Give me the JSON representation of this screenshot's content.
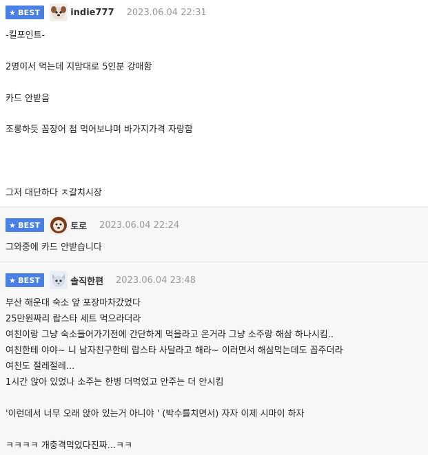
{
  "badge_label": "BEST",
  "colors": {
    "badge": "#4a80e6",
    "date": "#9a9a9a",
    "divider": "#e4e4e4"
  },
  "comments": [
    {
      "nickname": "indie777",
      "avatar": "dog-avatar",
      "datetime": "2023.06.04 22:31",
      "lines": [
        "-킬포인트-",
        "2명이서 먹는데 지맘대로 5인분 강매함",
        "카드 안받음",
        "조롱하듯 꼼장어 첨 먹어보냐며 바가지가격 자랑함",
        "그저 대단하다 ㅈ갈치시장"
      ]
    },
    {
      "nickname": "토로",
      "avatar": "lion-avatar",
      "datetime": "2023.06.04 22:24",
      "lines": [
        "그와중에 카드 안받습니다"
      ]
    },
    {
      "nickname": "솔직한편",
      "avatar": "cat-avatar",
      "datetime": "2023.06.04 23:48",
      "lines": [
        "부산 해운대 숙소 앞 포장마차갔었다",
        "25만원짜리 랍스타 세트 먹으라더라",
        "여친이랑 그냥 숙소들어가기전에 간단하게 먹을라고 온거라 그냥 소주랑 해삼 하나시킴..",
        "여친한테 야야~ 니 남자친구한테 랍스타 사달라고 해라~ 이러면서 해삼먹는데도 꼽주더라",
        "여친도 절레절레...",
        "1시간 앉아 있었나 소주는 한병 더먹었고 안주는 더 안시킴",
        "'이런데서 너무 오래 앉아 있는거 아니야 ' (박수를치면서) 자자 이제 시마이 하자",
        "ㅋㅋㅋㅋ 개충격먹었다진짜...ㅋㅋ"
      ]
    }
  ]
}
